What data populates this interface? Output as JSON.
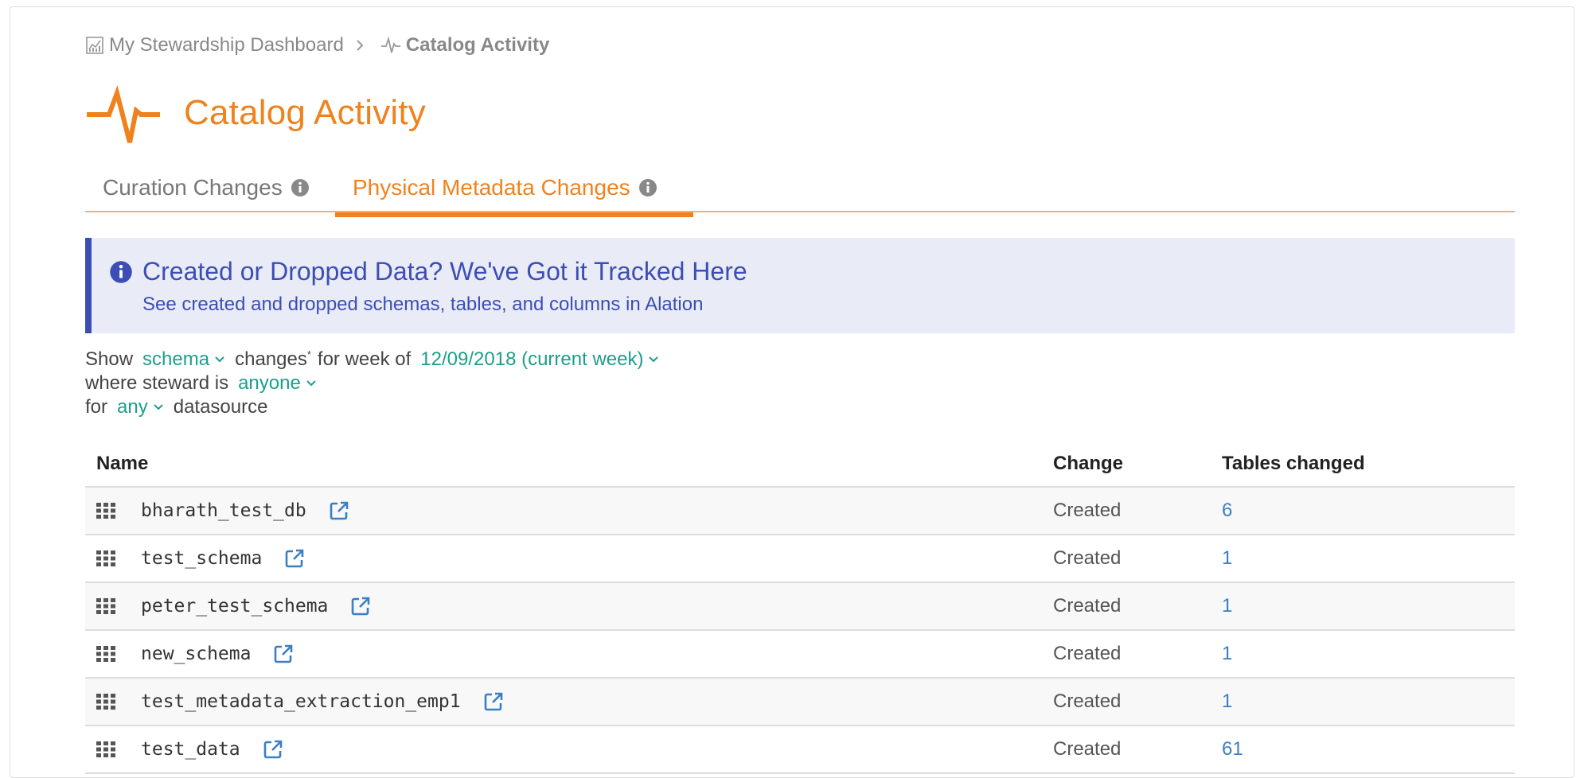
{
  "breadcrumb": {
    "parent": "My Stewardship Dashboard",
    "current": "Catalog Activity"
  },
  "page_title": "Catalog Activity",
  "tabs": [
    {
      "label": "Curation Changes",
      "active": false
    },
    {
      "label": "Physical Metadata Changes",
      "active": true
    }
  ],
  "alert": {
    "title": "Created or Dropped Data? We've Got it Tracked Here",
    "subtitle": "See created and dropped schemas, tables, and columns in Alation"
  },
  "filters": {
    "show_label": "Show",
    "object_type": "schema",
    "changes_label": "changes",
    "asterisk": "*",
    "week_label": "for week of",
    "week_value": "12/09/2018 (current week)",
    "steward_label": "where steward is",
    "steward_value": "anyone",
    "for_label": "for",
    "datasource_value": "any",
    "datasource_label": "datasource"
  },
  "table": {
    "headers": {
      "name": "Name",
      "change": "Change",
      "tables_changed": "Tables changed"
    },
    "rows": [
      {
        "name": "bharath_test_db",
        "change": "Created",
        "tables_changed": "6"
      },
      {
        "name": "test_schema",
        "change": "Created",
        "tables_changed": "1"
      },
      {
        "name": "peter_test_schema",
        "change": "Created",
        "tables_changed": "1"
      },
      {
        "name": "new_schema",
        "change": "Created",
        "tables_changed": "1"
      },
      {
        "name": "test_metadata_extraction_emp1",
        "change": "Created",
        "tables_changed": "1"
      },
      {
        "name": "test_data",
        "change": "Created",
        "tables_changed": "61"
      }
    ]
  },
  "colors": {
    "accent_orange": "#f0821e",
    "alert_blue": "#3c4db5",
    "alert_bg": "#e9ecf7",
    "dropdown_teal": "#1b9f8b",
    "link_blue": "#3b7ec4"
  },
  "icons": {
    "breadcrumb_parent": "chart-icon",
    "breadcrumb_current": "pulse-icon",
    "title": "pulse-icon",
    "tab_info": "info-circle-icon",
    "alert": "info-circle-icon",
    "row_type": "schema-grid-icon",
    "row_link": "external-link-icon",
    "dropdown": "chevron-down-icon"
  }
}
